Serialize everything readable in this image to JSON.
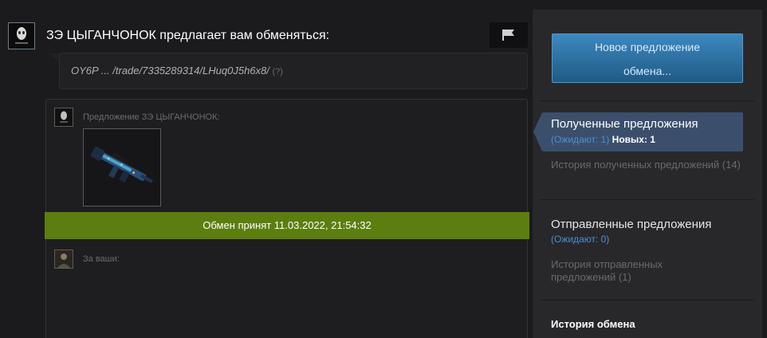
{
  "header": {
    "title": "ЗЭ ЦЫГАНЧОНОК предлагает вам обменяться:",
    "report_icon": "flag-icon"
  },
  "message": {
    "text": "OY6P ... /trade/7335289314/LHuq0J5h6x8/",
    "help": "(?)"
  },
  "offer": {
    "their_label": "Предложение ЗЭ ЦЫГАНЧОНОК:",
    "your_label": "За ваши:",
    "item_icon": "rifle-skin-icon"
  },
  "status": {
    "accepted": "Обмен принят 11.03.2022, 21:54:32",
    "color": "#5c7e10"
  },
  "sidebar": {
    "new_offer_line1": "Новое предложение",
    "new_offer_line2": "обмена...",
    "received": {
      "title": "Полученные предложения",
      "waiting": "(Ожидают: 1)",
      "new": "Новых: 1",
      "history": "История полученных предложений (14)"
    },
    "sent": {
      "title": "Отправленные предложения",
      "waiting": "(Ожидают: 0)",
      "history": "История отправленных предложений (1)"
    },
    "trade_history": "История обмена"
  },
  "colors": {
    "accent_button": "#2d6fa0",
    "active_nav": "#3b4f6c",
    "link_blue": "#4a8fd4"
  }
}
